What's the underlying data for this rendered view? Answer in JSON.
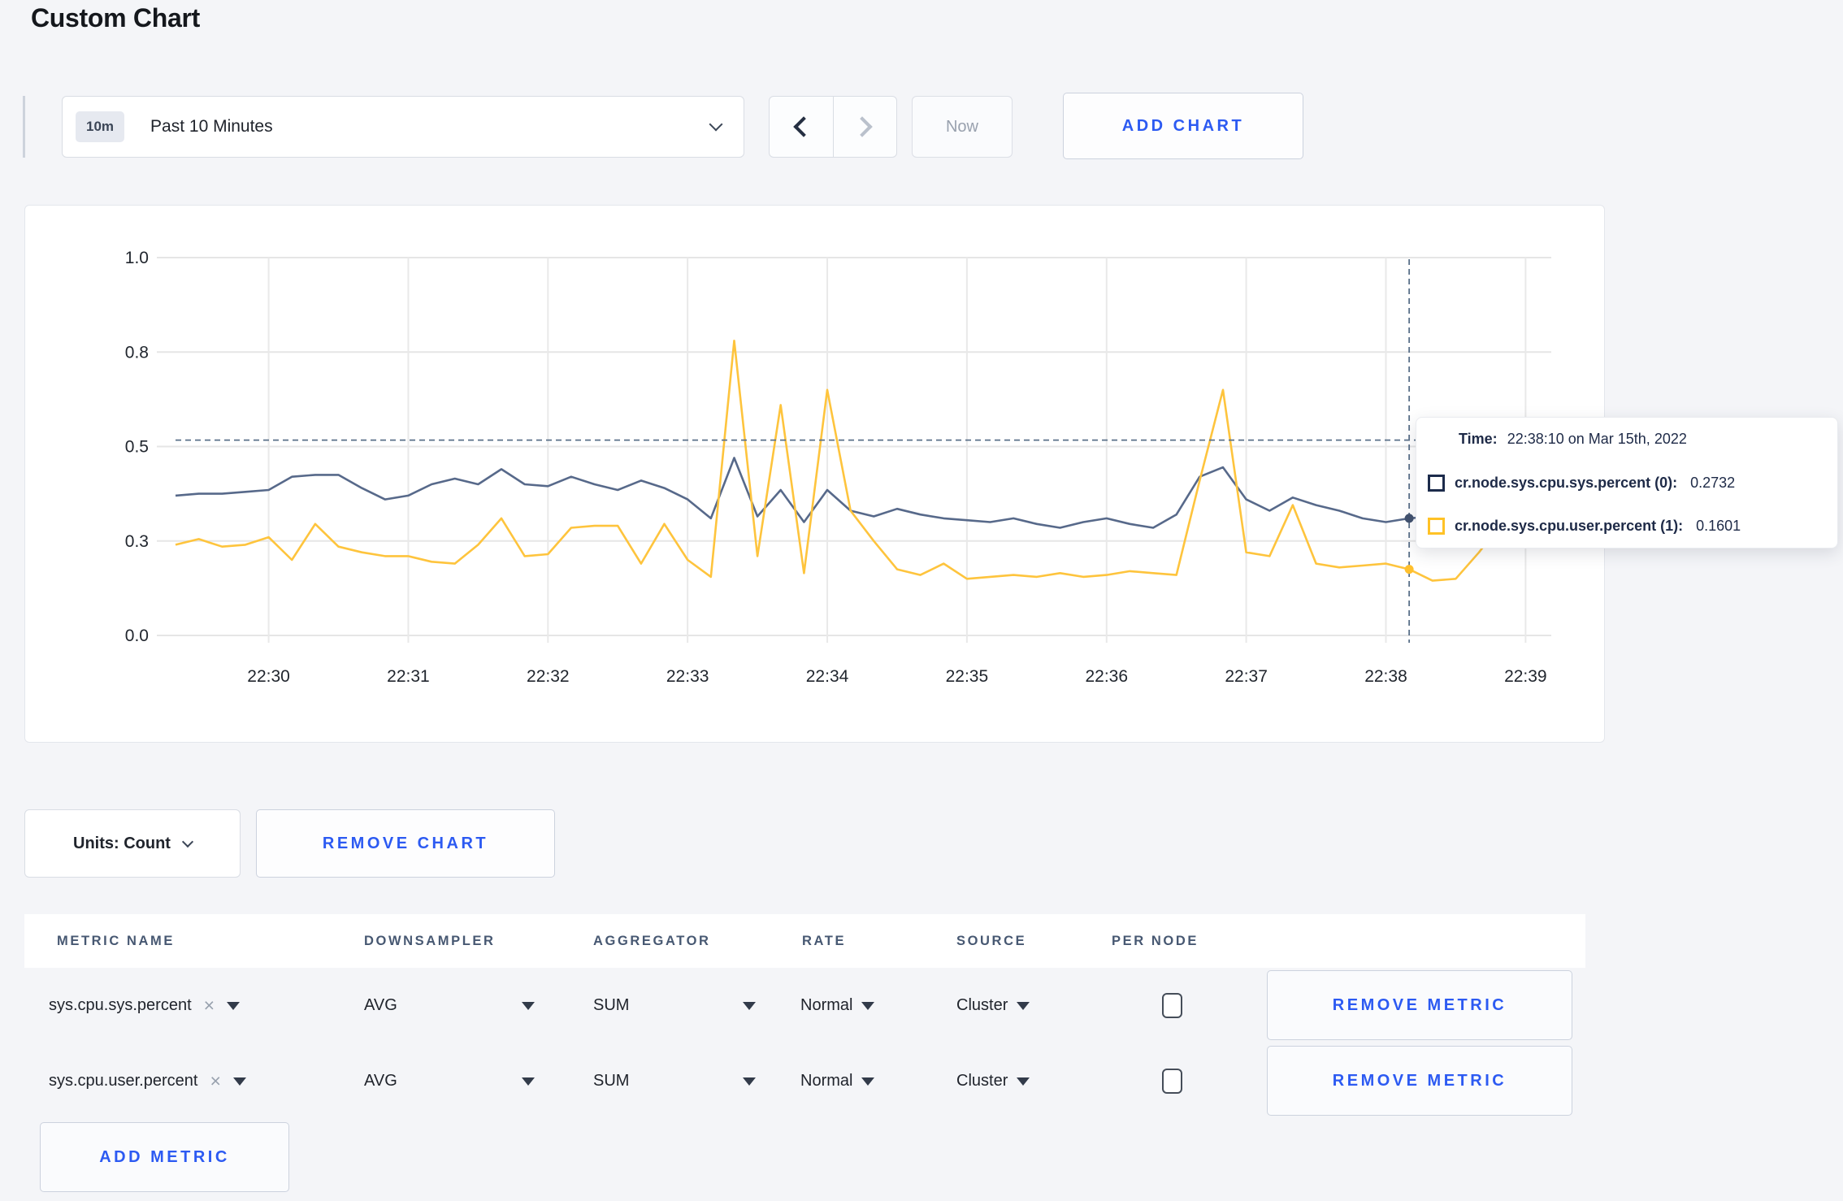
{
  "page": {
    "title": "Custom Chart"
  },
  "toolbar": {
    "time_range": {
      "badge": "10m",
      "label": "Past 10 Minutes"
    },
    "now_label": "Now",
    "add_chart_label": "ADD CHART"
  },
  "chart_data": {
    "type": "line",
    "title": "",
    "xlabel": "",
    "ylabel": "",
    "ylim": [
      0,
      1
    ],
    "grid": true,
    "legend_position": "none",
    "x_start": "22:29:20",
    "x_end": "22:39:10",
    "interval_seconds": 10,
    "x_tick_labels": [
      "22:30",
      "22:31",
      "22:32",
      "22:33",
      "22:34",
      "22:35",
      "22:36",
      "22:37",
      "22:38",
      "22:39"
    ],
    "y_ticks": [
      0,
      0.25,
      0.5,
      0.75,
      1.0
    ],
    "y_tick_labels": [
      "0.0",
      "0.3",
      "0.5",
      "0.8",
      "1.0"
    ],
    "series": [
      {
        "name": "cr.node.sys.cpu.sys.percent",
        "color": "#57698a",
        "dot_color": "#42526f",
        "values": [
          0.37,
          0.375,
          0.375,
          0.38,
          0.385,
          0.42,
          0.425,
          0.425,
          0.39,
          0.36,
          0.37,
          0.4,
          0.415,
          0.4,
          0.44,
          0.4,
          0.395,
          0.42,
          0.4,
          0.385,
          0.41,
          0.39,
          0.36,
          0.31,
          0.47,
          0.315,
          0.385,
          0.3,
          0.385,
          0.33,
          0.315,
          0.335,
          0.32,
          0.31,
          0.305,
          0.3,
          0.31,
          0.295,
          0.285,
          0.3,
          0.31,
          0.295,
          0.285,
          0.32,
          0.42,
          0.445,
          0.36,
          0.33,
          0.365,
          0.345,
          0.33,
          0.31,
          0.3,
          0.31,
          0.315,
          0.3,
          0.285,
          0.29,
          0.315,
          0.3
        ]
      },
      {
        "name": "cr.node.sys.cpu.user.percent",
        "color": "#fec43d",
        "dot_color": "#ffc02e",
        "values": [
          0.24,
          0.255,
          0.235,
          0.24,
          0.26,
          0.2,
          0.295,
          0.235,
          0.22,
          0.21,
          0.21,
          0.195,
          0.19,
          0.24,
          0.31,
          0.21,
          0.215,
          0.285,
          0.29,
          0.29,
          0.19,
          0.295,
          0.2,
          0.155,
          0.78,
          0.21,
          0.61,
          0.165,
          0.65,
          0.33,
          0.25,
          0.175,
          0.16,
          0.19,
          0.15,
          0.155,
          0.16,
          0.155,
          0.165,
          0.155,
          0.16,
          0.17,
          0.165,
          0.16,
          0.41,
          0.65,
          0.22,
          0.21,
          0.345,
          0.19,
          0.18,
          0.185,
          0.19,
          0.175,
          0.145,
          0.15,
          0.22,
          0.3,
          0.24,
          0.27
        ]
      }
    ],
    "hover": {
      "index": 53,
      "time": "22:38:10",
      "crosshair_y": 0.517
    }
  },
  "tooltip": {
    "time_label": "Time:",
    "time_value": "22:38:10 on Mar 15th, 2022",
    "rows": [
      {
        "label": "cr.node.sys.cpu.sys.percent (0):",
        "value": "0.2732",
        "color": "#1c2b4b"
      },
      {
        "label": "cr.node.sys.cpu.user.percent (1):",
        "value": "0.1601",
        "color": "#ffc226"
      }
    ]
  },
  "chart_controls": {
    "units_label": "Units: Count",
    "remove_chart_label": "REMOVE CHART"
  },
  "metrics_table": {
    "headers": [
      "METRIC NAME",
      "DOWNSAMPLER",
      "AGGREGATOR",
      "RATE",
      "SOURCE",
      "PER NODE"
    ],
    "clear_icon": "×",
    "rows": [
      {
        "name": "sys.cpu.sys.percent",
        "downsampler": "AVG",
        "aggregator": "SUM",
        "rate": "Normal",
        "source": "Cluster",
        "per_node_checked": false,
        "remove_label": "REMOVE METRIC"
      },
      {
        "name": "sys.cpu.user.percent",
        "downsampler": "AVG",
        "aggregator": "SUM",
        "rate": "Normal",
        "source": "Cluster",
        "per_node_checked": false,
        "remove_label": "REMOVE METRIC"
      }
    ],
    "add_metric_label": "ADD METRIC"
  }
}
